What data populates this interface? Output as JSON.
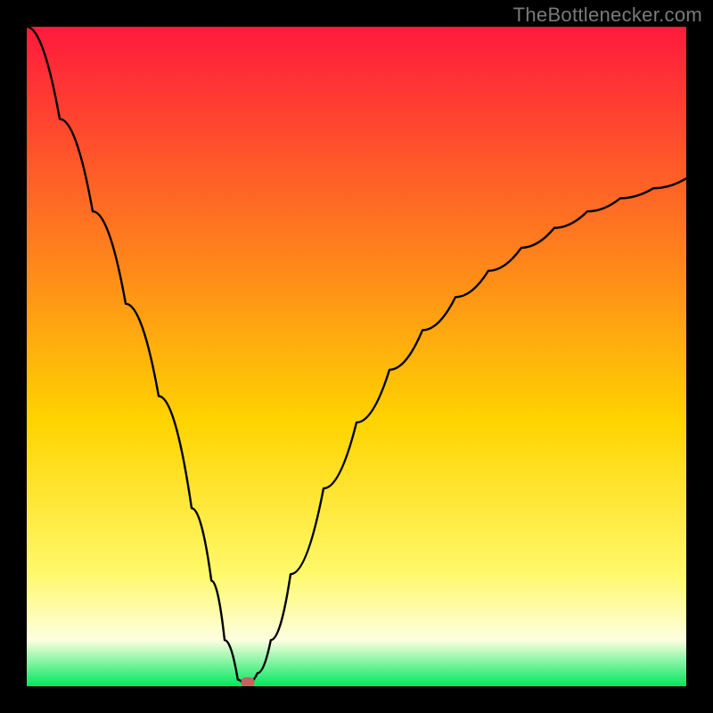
{
  "watermark": "TheBottlenecker.com",
  "colors": {
    "frame": "#000000",
    "gradient_top": "#ff1a3c",
    "gradient_mid1": "#ff7a1f",
    "gradient_mid2": "#ffd400",
    "gradient_mid3": "#fff96b",
    "gradient_band": "#fdffe0",
    "gradient_bottom": "#00e85e",
    "curve": "#000000",
    "marker_fill": "#c0655e",
    "marker_stroke": "#c0655e"
  },
  "chart_data": {
    "type": "line",
    "title": "",
    "xlabel": "",
    "ylabel": "",
    "xlim": [
      0,
      100
    ],
    "ylim": [
      0,
      100
    ],
    "left_branch": {
      "x": [
        0,
        5,
        10,
        15,
        20,
        25,
        28,
        30,
        32,
        33
      ],
      "y": [
        100,
        86,
        72,
        58,
        44,
        27,
        16,
        7,
        1,
        0
      ]
    },
    "right_branch": {
      "x": [
        33,
        35,
        37,
        40,
        45,
        50,
        55,
        60,
        65,
        70,
        75,
        80,
        85,
        90,
        95,
        100
      ],
      "y": [
        0,
        2,
        7,
        17,
        30,
        40,
        48,
        54,
        59,
        63,
        66.5,
        69.5,
        72,
        74,
        75.5,
        77
      ]
    },
    "marker": {
      "x": 33.5,
      "y": 0.6
    }
  }
}
